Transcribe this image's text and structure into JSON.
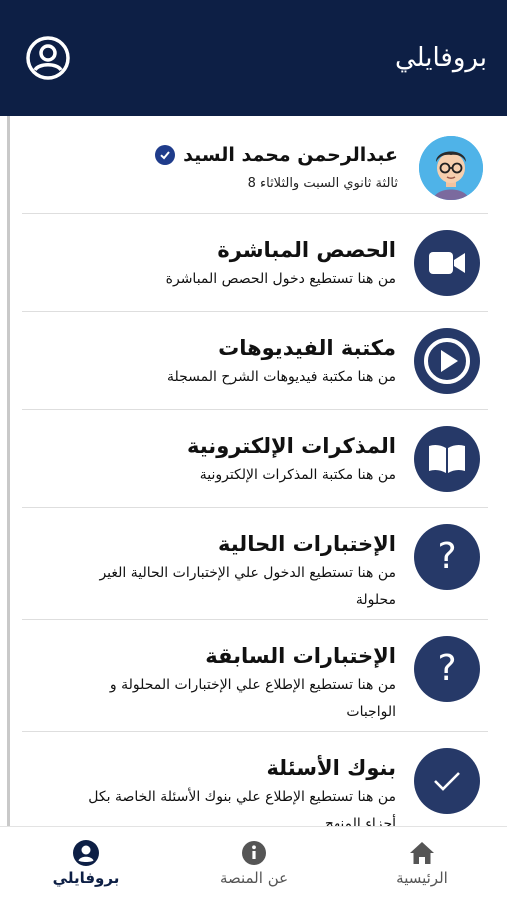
{
  "header": {
    "title": "بروفايلي",
    "account_icon": "account-circle-icon"
  },
  "profile": {
    "name": "عبدالرحمن محمد السيد",
    "subtitle": "ثالثة ثانوي السبت والثلاثاء 8",
    "verified_icon": "verified-check-icon"
  },
  "menu": [
    {
      "icon": "video-camera-icon",
      "title": "الحصص المباشرة",
      "desc": "من هنا تستطيع دخول الحصص المباشرة"
    },
    {
      "icon": "play-icon",
      "title": "مكتبة الفيديوهات",
      "desc": "من هنا مكتبة فيديوهات الشرح المسجلة"
    },
    {
      "icon": "book-icon",
      "title": "المذكرات الإلكترونية",
      "desc": "من هنا مكتبة المذكرات الإلكترونية"
    },
    {
      "icon": "question-mark-icon",
      "title": "الإختبارات الحالية",
      "desc": "من هنا تستطيع الدخول علي الإختبارات الحالية الغير محلولة"
    },
    {
      "icon": "question-mark-icon",
      "title": "الإختبارات السابقة",
      "desc": "من هنا تستطيع الإطلاع علي الإختبارات المحلولة و الواجبات"
    },
    {
      "icon": "checkmark-icon",
      "title": "بنوك الأسئلة",
      "desc": "من هنا تستطيع الإطلاع علي بنوك الأسئلة الخاصة بكل أجزاء المنهج"
    }
  ],
  "bottom_nav": {
    "profile": {
      "label": "بروفايلي",
      "icon": "person-icon",
      "active": true
    },
    "about": {
      "label": "عن المنصة",
      "icon": "info-icon",
      "active": false
    },
    "home": {
      "label": "الرئيسية",
      "icon": "home-icon",
      "active": false
    }
  },
  "colors": {
    "primary": "#0d1f45",
    "icon_circle": "#263968",
    "avatar_bg": "#4fb3e8"
  }
}
